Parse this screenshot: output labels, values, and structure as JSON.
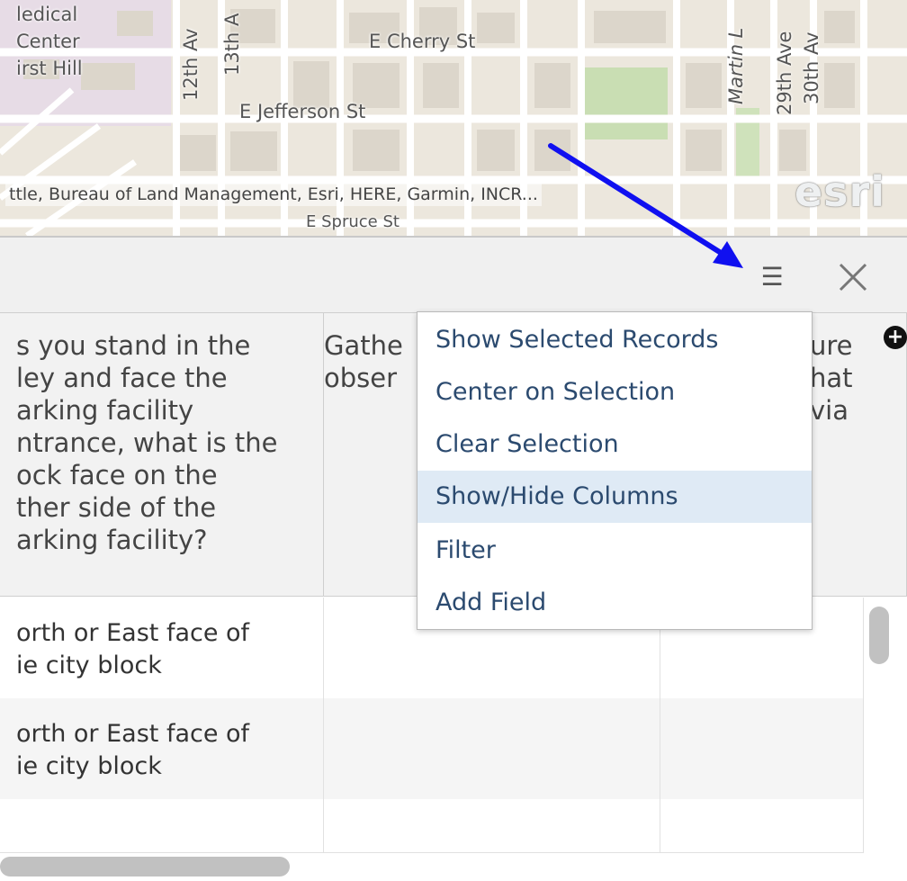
{
  "map": {
    "street_labels": [
      {
        "id": "medical",
        "text": "ledical"
      },
      {
        "id": "center",
        "text": "Center"
      },
      {
        "id": "first-hill",
        "text": "irst Hill"
      },
      {
        "id": "cherry",
        "text": "E Cherry St"
      },
      {
        "id": "jefferson",
        "text": "E Jefferson St"
      },
      {
        "id": "spruce",
        "text": "E Spruce St"
      },
      {
        "id": "12th",
        "text": "12th Av"
      },
      {
        "id": "13th",
        "text": "13th A"
      },
      {
        "id": "martin",
        "text": "Martin L"
      },
      {
        "id": "29th",
        "text": "29th Ave"
      },
      {
        "id": "30th",
        "text": "30th Av"
      }
    ],
    "attribution": "ttle, Bureau of Land Management, Esri, HERE, Garmin, INCR...",
    "logo": "esri",
    "colors": {
      "background": "#ece7dd",
      "block": "#e2ddd3",
      "park": "#c9deb3",
      "hospital": "#e7dce6"
    }
  },
  "panel": {
    "menu_icon": "☰",
    "close_icon": "close-icon"
  },
  "table": {
    "columns": [
      {
        "header": "s you stand in the\nley and face the\narking facility\nntrance, what is the\nock face on the\nther side of the\narking facility?"
      },
      {
        "header": "Gathe\nobser"
      },
      {
        "header": "ure\nhat\nvia"
      }
    ],
    "rows": [
      {
        "cells": [
          "orth or East face of\nie city block",
          "",
          ""
        ]
      },
      {
        "cells": [
          "orth or East face of\nie city block",
          "",
          ""
        ]
      },
      {
        "cells": [
          "",
          "",
          ""
        ]
      }
    ],
    "add_column_icon": "+"
  },
  "menu": {
    "items": [
      {
        "label": "Show Selected Records",
        "highlighted": false
      },
      {
        "label": "Center on Selection",
        "highlighted": false
      },
      {
        "label": "Clear Selection",
        "highlighted": false
      },
      {
        "label": "Show/Hide Columns",
        "highlighted": true
      },
      {
        "label": "Filter",
        "highlighted": false
      },
      {
        "label": "Add Field",
        "highlighted": false
      }
    ],
    "text_color": "#2b4a6f",
    "highlight_color": "#dfeaf5"
  },
  "annotation": {
    "arrow_color": "#1010f0"
  }
}
